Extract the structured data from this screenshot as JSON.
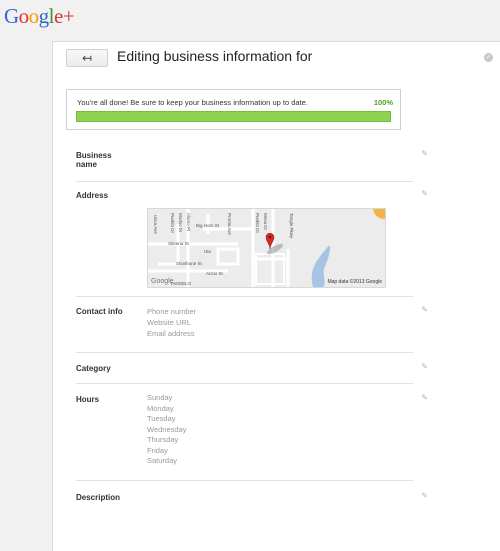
{
  "logo": {
    "text": "Google+",
    "colors": [
      "#3366cc",
      "#dd3333",
      "#ff9900",
      "#3366cc",
      "#339933",
      "#dd3333",
      "#dd3333"
    ]
  },
  "header": {
    "back_icon": "arrow-back-icon",
    "title": "Editing business information for"
  },
  "banner": {
    "message": "You're all done! Be sure to keep your business information up to date.",
    "percent_label": "100%",
    "progress": 1.0,
    "accent": "#8fd451"
  },
  "sections": {
    "business_name": {
      "label_line1": "Business",
      "label_line2": "name"
    },
    "address": {
      "label": "Address",
      "map": {
        "streets": [
          "Utica Ave",
          "Pueblo Dr",
          "Modoc Dr",
          "Alamo Pl",
          "Skeena St",
          "Big Horn St",
          "Ute",
          "Shoshone St",
          "Anzio St",
          "Pronta Ave",
          "Pueblo Dr",
          "Mesa Dr",
          "Tangle Pkwy",
          "TANGELO"
        ],
        "data_label": "Map data ©2013 Google",
        "logo_text": "Google"
      }
    },
    "contact": {
      "label": "Contact info",
      "fields": [
        "Phone number",
        "Website URL",
        "Email address"
      ]
    },
    "category": {
      "label": "Category"
    },
    "hours": {
      "label": "Hours",
      "days": [
        "Sunday",
        "Monday",
        "Tuesday",
        "Wednesday",
        "Thursday",
        "Friday",
        "Saturday"
      ]
    },
    "description": {
      "label": "Description"
    }
  }
}
